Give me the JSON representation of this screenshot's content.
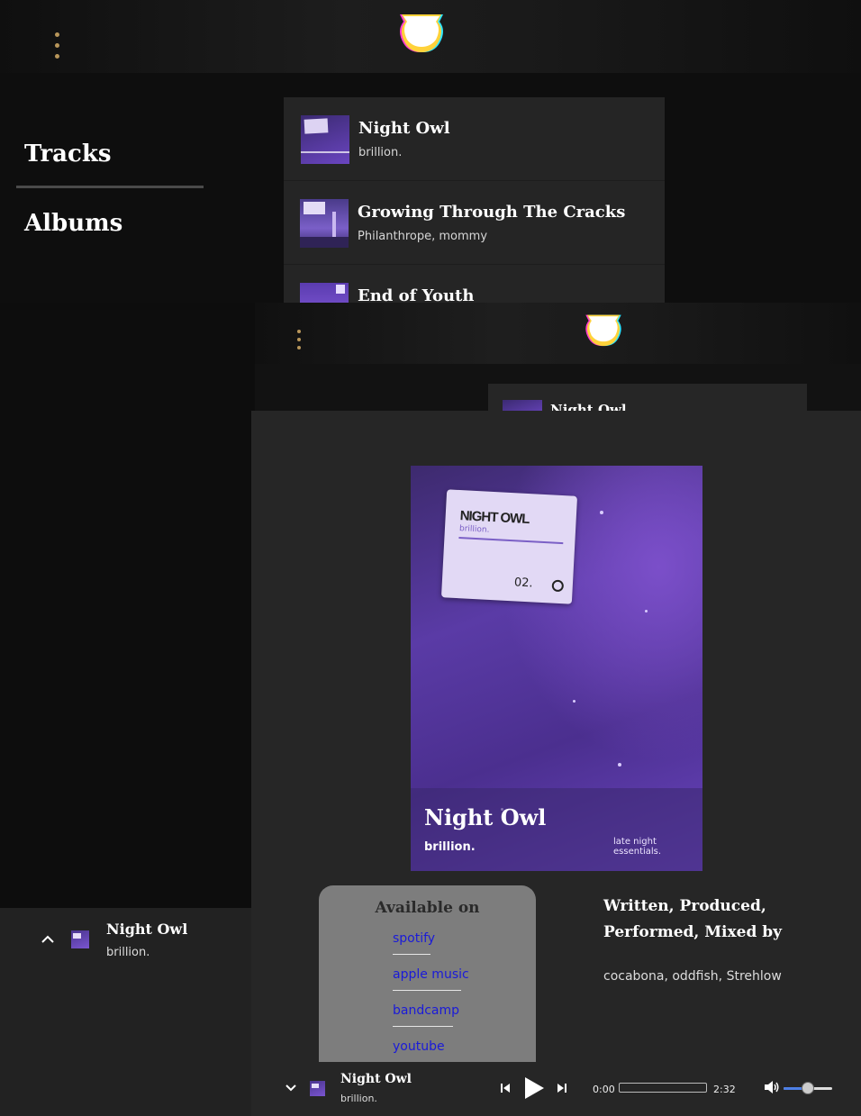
{
  "nav": {
    "tracks_label": "Tracks",
    "albums_label": "Albums"
  },
  "tracks": [
    {
      "title": "Night Owl",
      "artist": "brillion."
    },
    {
      "title": "Growing Through The Cracks",
      "artist": "Philanthrope, mommy"
    },
    {
      "title": "End of Youth",
      "artist": ""
    }
  ],
  "back_list": {
    "first_title": "Night Owl"
  },
  "mini_player": {
    "title": "Night Owl",
    "artist": "brillion."
  },
  "detail": {
    "cover": {
      "card_title": "NIGHT OWL",
      "card_artist": "brillion.",
      "card_number": "02.",
      "tagline": "late night essentials.",
      "overlay_title": "Night Owl",
      "overlay_artist": "brillion."
    },
    "available": {
      "heading": "Available on",
      "platforms": [
        "spotify",
        "apple music",
        "bandcamp",
        "youtube"
      ]
    },
    "credits": {
      "heading": "Written, Produced, Performed, Mixed by",
      "names": "cocabona, oddfish, Strehlow"
    }
  },
  "player": {
    "title": "Night Owl",
    "artist": "brillion.",
    "current_time": "0:00",
    "duration": "2:32",
    "progress": 0,
    "volume": 0.5
  },
  "colors": {
    "accent_dots": "#b8965a",
    "link": "#1a1ad9",
    "volume_fill": "#4d7fe6"
  }
}
